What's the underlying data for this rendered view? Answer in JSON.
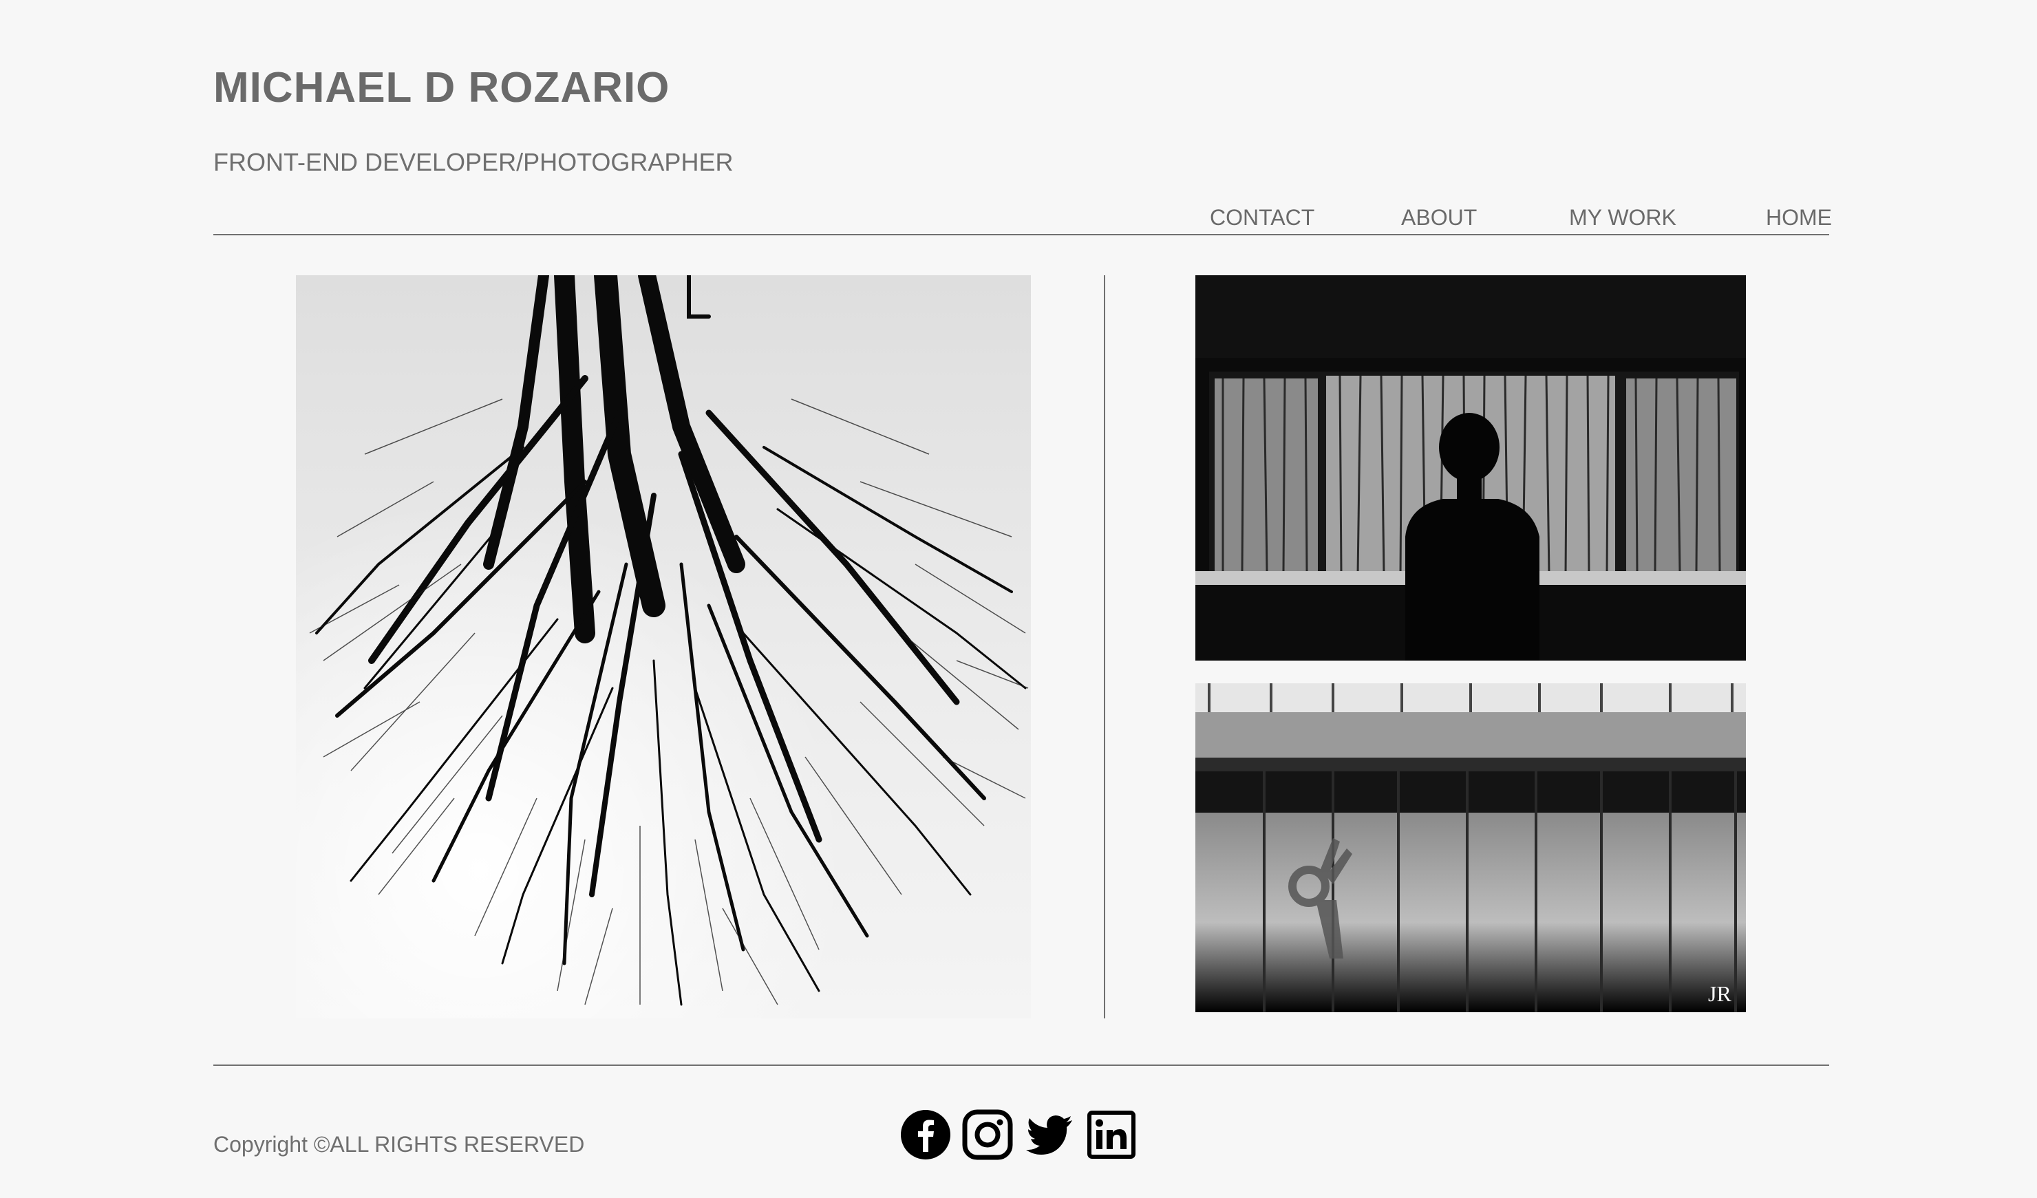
{
  "header": {
    "title": "MICHAEL D ROZARIO",
    "subtitle": "FRONT-END DEVELOPER/PHOTOGRAPHER"
  },
  "nav": {
    "items": [
      {
        "label": "CONTACT"
      },
      {
        "label": "ABOUT"
      },
      {
        "label": "MY WORK"
      },
      {
        "label": "HOME"
      }
    ]
  },
  "gallery": {
    "watermark": "JR"
  },
  "footer": {
    "copyright": "Copyright ©ALL RIGHTS RESERVED",
    "social": [
      {
        "icon": "facebook-icon"
      },
      {
        "icon": "instagram-icon"
      },
      {
        "icon": "twitter-icon"
      },
      {
        "icon": "linkedin-icon"
      }
    ]
  }
}
